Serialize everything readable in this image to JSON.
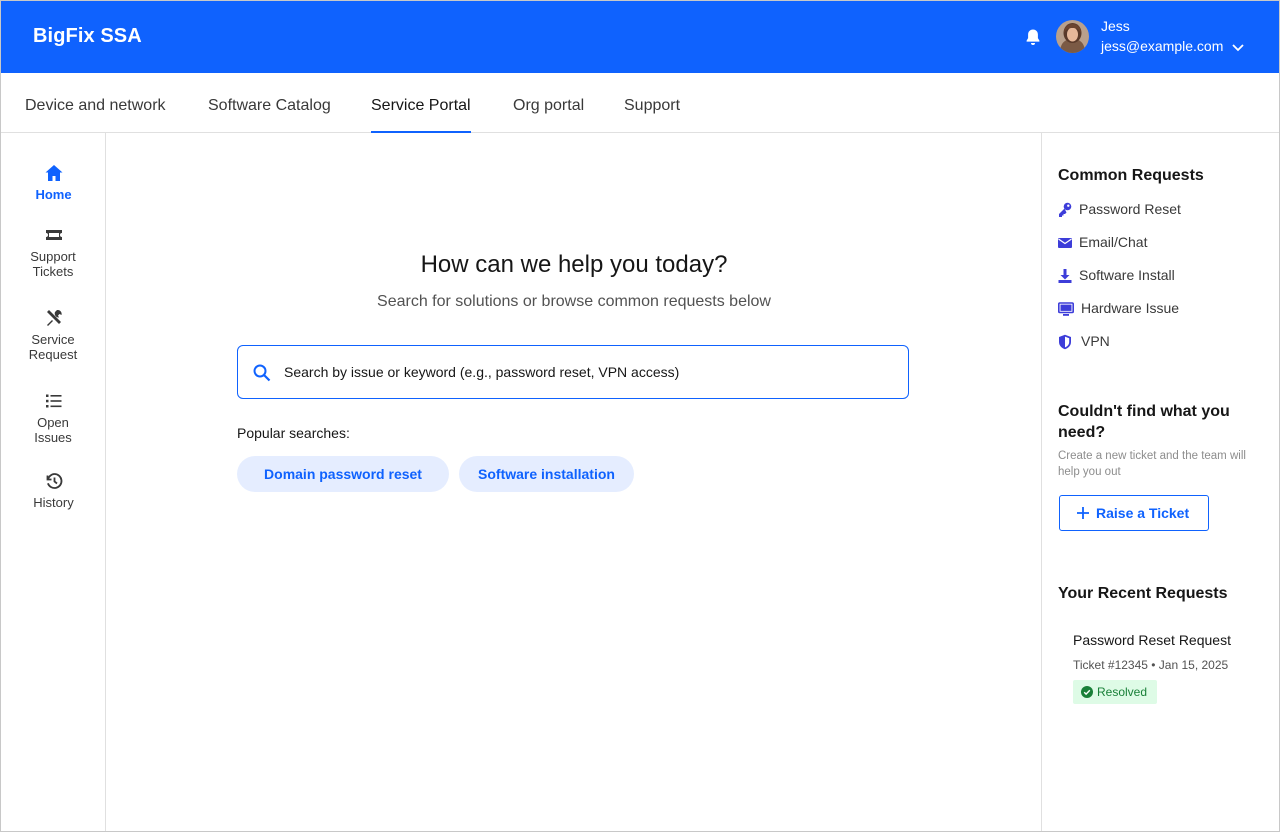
{
  "header": {
    "brand": "BigFix SSA",
    "user": {
      "name": "Jess",
      "email": "jess@example.com"
    }
  },
  "tabs": [
    {
      "label": "Device and network",
      "active": false
    },
    {
      "label": "Software Catalog",
      "active": false
    },
    {
      "label": "Service Portal",
      "active": true
    },
    {
      "label": "Org portal",
      "active": false
    },
    {
      "label": "Support",
      "active": false
    }
  ],
  "sidebar": {
    "items": [
      {
        "label": "Home",
        "icon": "home-icon",
        "active": true
      },
      {
        "label": "Support Tickets",
        "icon": "ticket-icon",
        "active": false
      },
      {
        "label": "Service Request",
        "icon": "tools-icon",
        "active": false
      },
      {
        "label": "Open Issues",
        "icon": "list-icon",
        "active": false
      },
      {
        "label": "History",
        "icon": "history-icon",
        "active": false
      }
    ]
  },
  "main": {
    "title": "How can we help you today?",
    "subtitle": "Search for solutions or browse common requests below",
    "search": {
      "placeholder": "Search by issue or keyword (e.g., password reset, VPN access)",
      "value": ""
    },
    "popular_label": "Popular searches:",
    "popular": [
      "Domain password reset",
      "Software installation"
    ]
  },
  "right_panel": {
    "common_title": "Common Requests",
    "common": [
      {
        "label": "Password Reset",
        "icon": "key-icon"
      },
      {
        "label": "Email/Chat",
        "icon": "envelope-icon"
      },
      {
        "label": "Software Install",
        "icon": "download-icon"
      },
      {
        "label": "Hardware Issue",
        "icon": "monitor-icon"
      },
      {
        "label": "VPN",
        "icon": "shield-icon"
      }
    ],
    "help_title": "Couldn't find what you need?",
    "help_note": "Create a new ticket and the team will help you out",
    "raise_label": "Raise a Ticket",
    "recent_title": "Your Recent Requests",
    "recent": [
      {
        "title": "Password Reset Request",
        "meta": "Ticket #12345 • Jan 15, 2025",
        "status": "Resolved"
      }
    ]
  },
  "colors": {
    "primary": "#0f62fe",
    "chip_bg": "#e5edff",
    "success_bg": "#defbe6",
    "success_text": "#198038",
    "icon_purple": "#3d3dd9"
  }
}
